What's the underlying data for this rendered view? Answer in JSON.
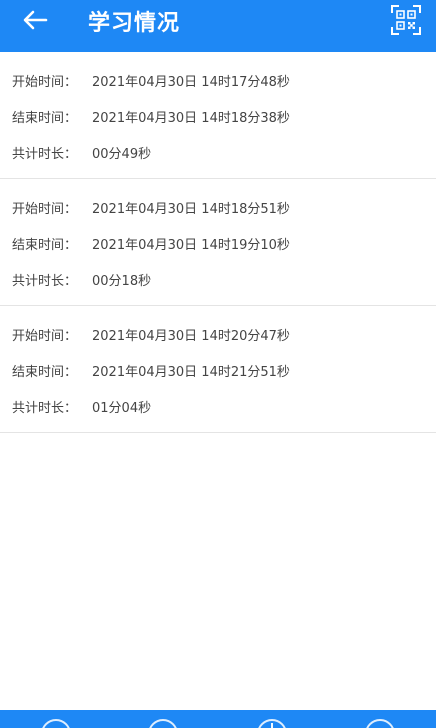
{
  "header": {
    "title": "学习情况",
    "back_icon": "arrow-left-icon",
    "qr_icon": "qr-code-scan-icon",
    "bg_color": "#1e88f5"
  },
  "records": [
    {
      "start_label": "开始时间：",
      "start_value": "2021年04月30日 14时17分48秒",
      "end_label": "结束时间：",
      "end_value": "2021年04月30日 14时18分38秒",
      "duration_label": "共计时长：",
      "duration_value": "00分49秒"
    },
    {
      "start_label": "开始时间：",
      "start_value": "2021年04月30日 14时18分51秒",
      "end_label": "结束时间：",
      "end_value": "2021年04月30日 14时19分10秒",
      "duration_label": "共计时长：",
      "duration_value": "00分18秒"
    },
    {
      "start_label": "开始时间：",
      "start_value": "2021年04月30日 14时20分47秒",
      "end_label": "结束时间：",
      "end_value": "2021年04月30日 14时21分51秒",
      "duration_label": "共计时长：",
      "duration_value": "01分04秒"
    }
  ],
  "bottom_nav": {
    "items": [
      "nav-item-1-icon",
      "nav-item-2-icon",
      "nav-item-3-icon",
      "nav-item-4-icon"
    ]
  }
}
